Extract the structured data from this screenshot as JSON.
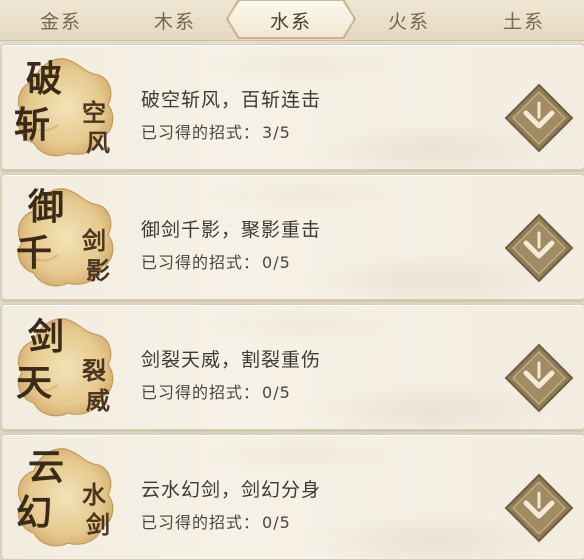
{
  "tabs": [
    {
      "label": "金系"
    },
    {
      "label": "木系"
    },
    {
      "label": "水系",
      "active": true
    },
    {
      "label": "火系"
    },
    {
      "label": "土系"
    }
  ],
  "skills": [
    {
      "badge": [
        "破",
        "斩",
        "空",
        "风"
      ],
      "title": "破空斩风，百斩连击",
      "progress_label": "已习得的招式：",
      "progress": "3/5"
    },
    {
      "badge": [
        "御",
        "千",
        "剑",
        "影"
      ],
      "title": "御剑千影，聚影重击",
      "progress_label": "已习得的招式：",
      "progress": "0/5"
    },
    {
      "badge": [
        "剑",
        "天",
        "裂",
        "威"
      ],
      "title": "剑裂天威，割裂重伤",
      "progress_label": "已习得的招式：",
      "progress": "0/5"
    },
    {
      "badge": [
        "云",
        "幻",
        "水",
        "剑"
      ],
      "title": "云水幻剑，剑幻分身",
      "progress_label": "已习得的招式：",
      "progress": "0/5"
    }
  ],
  "colors": {
    "tab_text": "#7a6647",
    "accent_button": "#8d7a55"
  },
  "icons": {
    "expand": "chevron-down-icon"
  }
}
